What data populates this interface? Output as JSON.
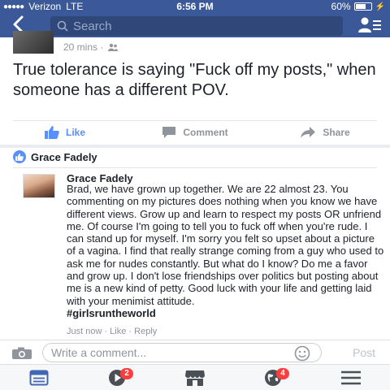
{
  "status_bar": {
    "carrier": "Verizon",
    "network": "LTE",
    "time": "6:56 PM",
    "battery_percent": "60%",
    "battery_level": 0.6
  },
  "nav": {
    "search_placeholder": "Search"
  },
  "post": {
    "time_ago": "20 mins ·",
    "text": "True tolerance is saying \"Fuck off my posts,\" when someone has a different POV.",
    "actions": {
      "like": "Like",
      "comment": "Comment",
      "share": "Share"
    }
  },
  "likes": {
    "names": "Grace Fadely"
  },
  "comment": {
    "author": "Grace Fadely",
    "body": "Brad, we have grown up together. We are 22 almost 23. You commenting on my pictures does nothing when you know we have different views. Grow up and learn to respect my posts OR unfriend me. Of course I'm going to tell you to fuck off when you're rude. I can stand up for myself. I'm sorry you felt so upset about a picture of a vagina. I find that really strange coming from a guy who used to ask me for nudes constantly. But what do I know? Do me a favor and grow up. I don't lose friendships over politics but posting about me is a new kind of petty. Good luck with your life and getting laid with your menimist attitude.",
    "hashtag": "#girlsruntheworld",
    "meta": "Just now · Like · Reply"
  },
  "compose": {
    "placeholder": "Write a comment...",
    "post_label": "Post"
  },
  "tab_bar": {
    "video_badge": "2",
    "notifications_badge": "4"
  },
  "colors": {
    "brand": "#3b5998",
    "like_blue": "#5890ff",
    "badge_red": "#fa3e3e"
  },
  "icons": [
    "back-icon",
    "search-icon",
    "friends-icon",
    "public-audience-icon",
    "like-icon",
    "comment-icon",
    "share-icon",
    "camera-icon",
    "smiley-icon",
    "news-feed-icon",
    "video-icon",
    "marketplace-icon",
    "notifications-globe-icon",
    "menu-icon"
  ]
}
